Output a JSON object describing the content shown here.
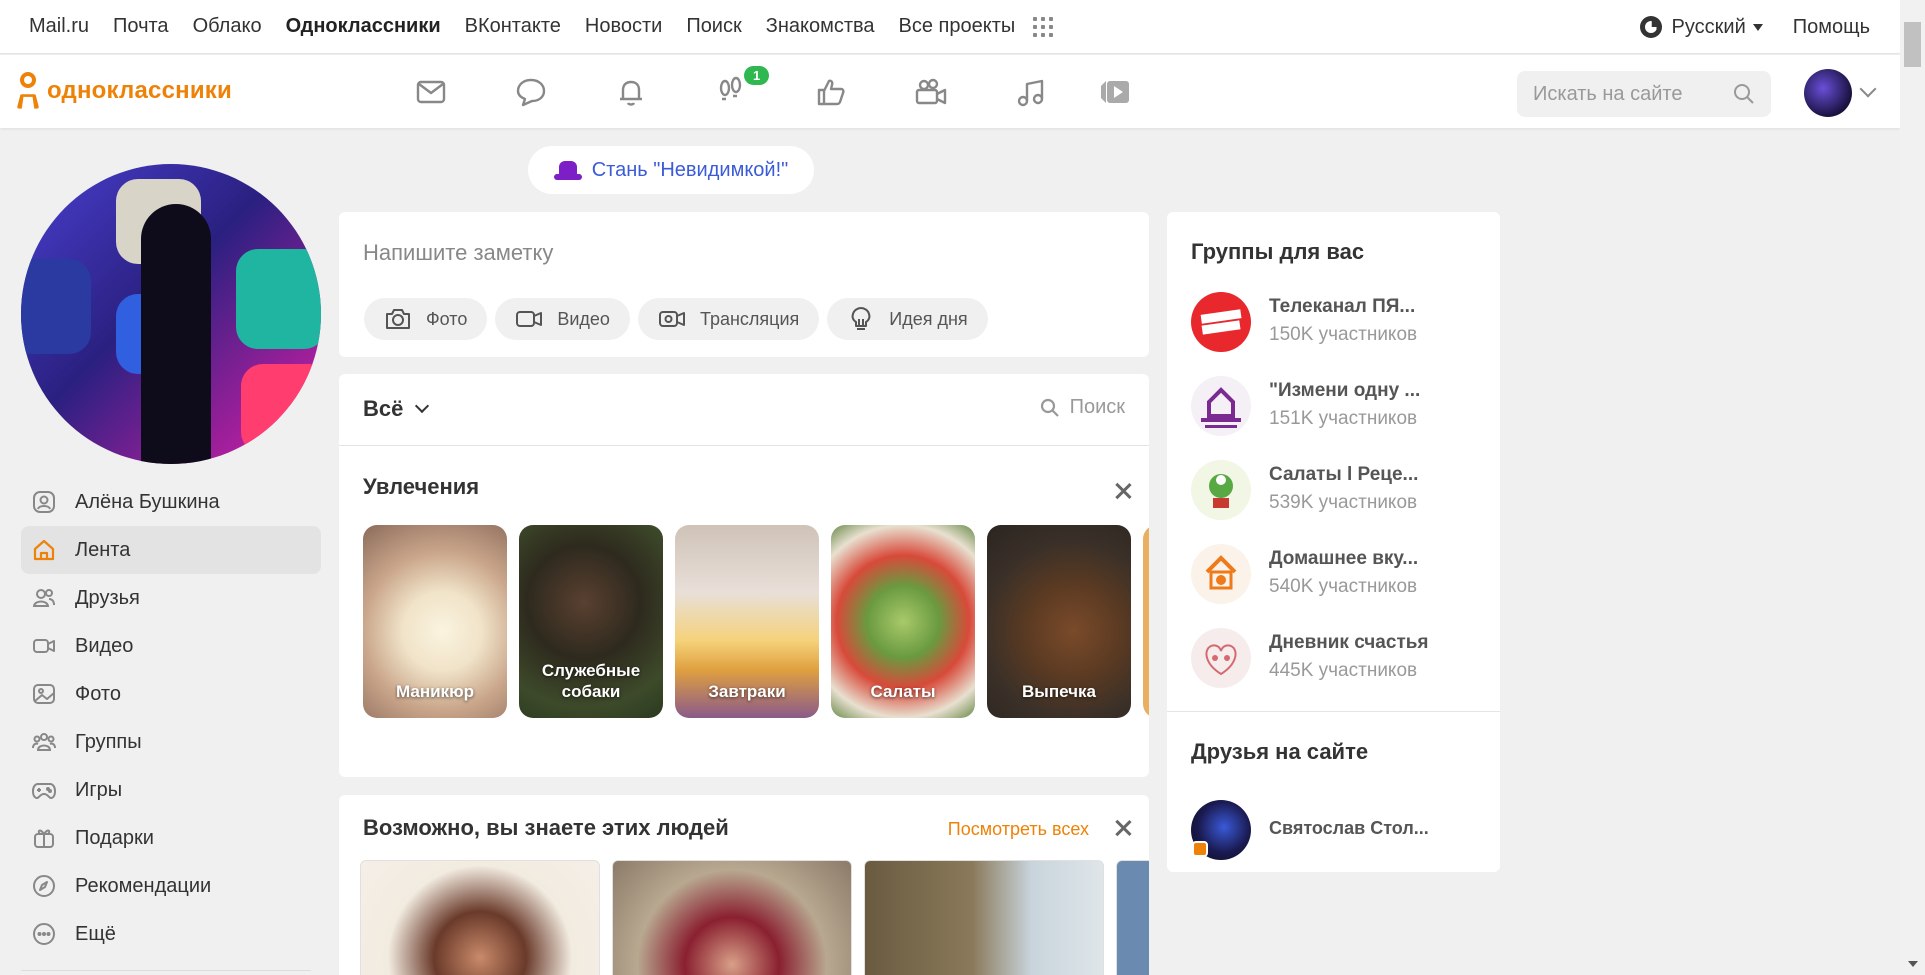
{
  "portal": {
    "links": [
      "Mail.ru",
      "Почта",
      "Облако",
      "Одноклассники",
      "ВКонтакте",
      "Новости",
      "Поиск",
      "Знакомства",
      "Все проекты"
    ],
    "active_link": "Одноклассники",
    "language": "Русский",
    "help": "Помощь"
  },
  "header": {
    "logo_text": "одноклассники",
    "nav_icons": [
      "messages-icon",
      "discussions-icon",
      "notifications-icon",
      "guests-icon",
      "events-icon",
      "video-icon",
      "music-icon",
      "videogame-icon"
    ],
    "guests_badge": "1",
    "search_placeholder": "Искать на сайте"
  },
  "banner": {
    "invisible_label": "Стань \"Невидимкой!\""
  },
  "sidebar": {
    "items": [
      {
        "label": "Алёна Бушкина",
        "icon": "profile-icon"
      },
      {
        "label": "Лента",
        "icon": "home-icon",
        "active": true
      },
      {
        "label": "Друзья",
        "icon": "friends-icon"
      },
      {
        "label": "Видео",
        "icon": "video-icon"
      },
      {
        "label": "Фото",
        "icon": "photo-icon"
      },
      {
        "label": "Группы",
        "icon": "groups-icon"
      },
      {
        "label": "Игры",
        "icon": "gamepad-icon"
      },
      {
        "label": "Подарки",
        "icon": "gift-icon"
      },
      {
        "label": "Рекомендации",
        "icon": "compass-icon"
      },
      {
        "label": "Ещё",
        "icon": "more-icon"
      }
    ]
  },
  "note": {
    "placeholder": "Напишите заметку",
    "actions": [
      {
        "label": "Фото",
        "icon": "camera-icon"
      },
      {
        "label": "Видео",
        "icon": "video-camera-icon"
      },
      {
        "label": "Трансляция",
        "icon": "broadcast-icon"
      },
      {
        "label": "Идея дня",
        "icon": "lightbulb-icon"
      }
    ]
  },
  "feed": {
    "filter": "Всё",
    "search_label": "Поиск",
    "hobbies_title": "Увлечения",
    "hobbies": [
      "Маникюр",
      "Служебные собаки",
      "Завтраки",
      "Салаты",
      "Выпечка"
    ],
    "people_title": "Возможно, вы знаете этих людей",
    "see_all": "Посмотреть всех"
  },
  "right": {
    "groups_title": "Группы для вас",
    "groups": [
      {
        "name": "Телеканал ПЯ...",
        "members": "150K участников"
      },
      {
        "name": "\"Измени одну ...",
        "members": "151K участников"
      },
      {
        "name": "Салаты l Реце...",
        "members": "539K участников"
      },
      {
        "name": "Домашнее вку...",
        "members": "540K участников"
      },
      {
        "name": "Дневник счастья",
        "members": "445K участников"
      }
    ],
    "friends_title": "Друзья на сайте",
    "friends": [
      {
        "name": "Святослав Стол..."
      }
    ]
  },
  "colors": {
    "brand": "#ee8208",
    "badge": "#2eb84f",
    "link": "#3b5bd8"
  }
}
